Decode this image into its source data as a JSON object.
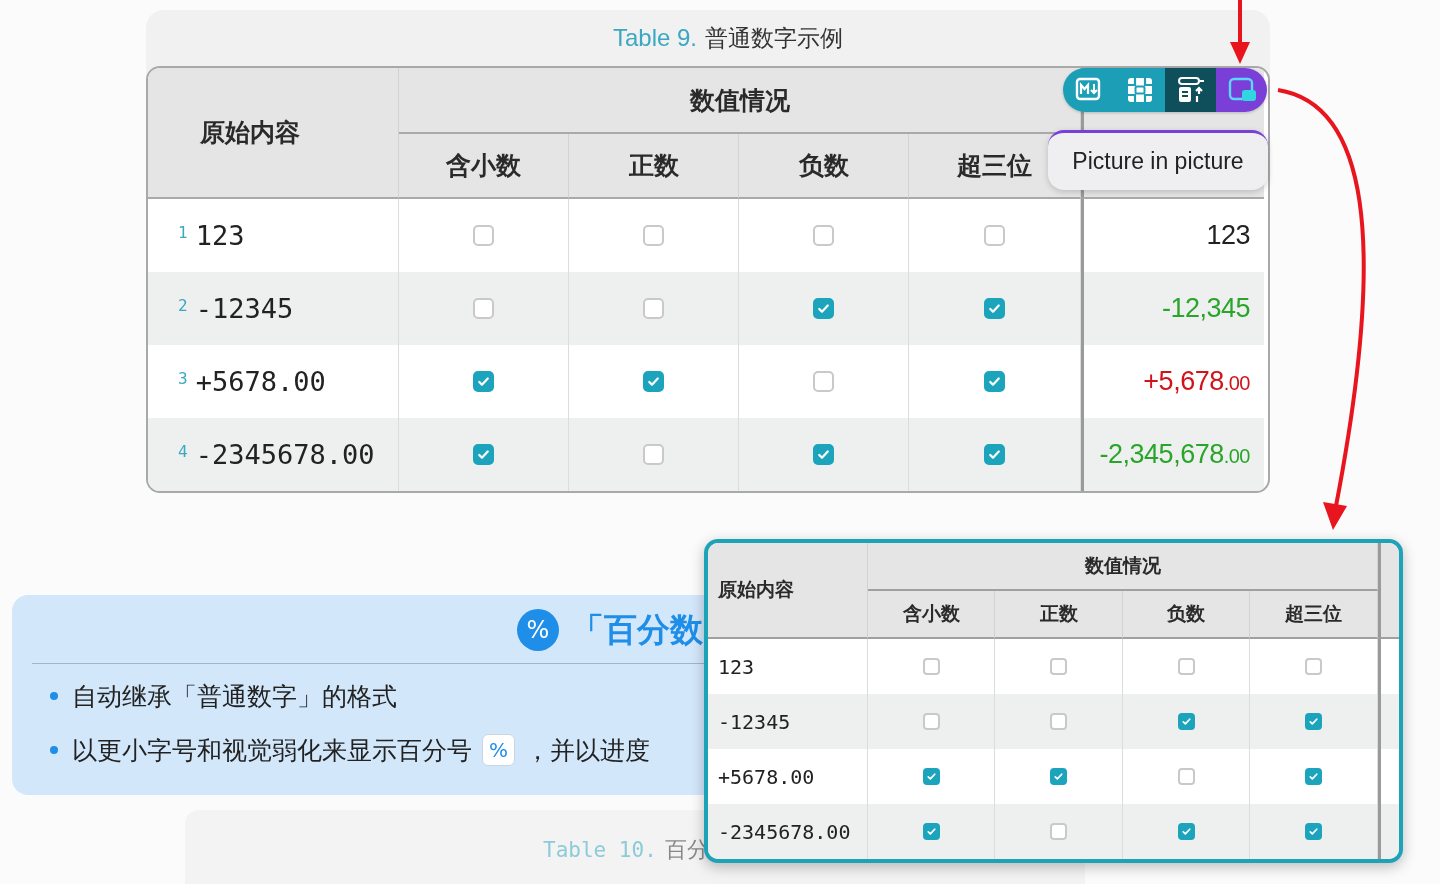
{
  "main_table": {
    "caption": {
      "label": "Table 9.",
      "title": "普通数字示例"
    },
    "first_header": "原始内容",
    "group_header": "数值情况",
    "columns": [
      "含小数",
      "正数",
      "负数",
      "超三位"
    ],
    "rows": [
      {
        "index": "1",
        "raw": "123",
        "checks": [
          false,
          false,
          false,
          false
        ],
        "value": "123",
        "kind": "neutral"
      },
      {
        "index": "2",
        "raw": "-12345",
        "checks": [
          false,
          false,
          true,
          true
        ],
        "value": "-12,345",
        "kind": "negative"
      },
      {
        "index": "3",
        "raw": "+5678.00",
        "checks": [
          true,
          true,
          false,
          true
        ],
        "value": "+5,678",
        "decimals": ".00",
        "kind": "positive"
      },
      {
        "index": "4",
        "raw": "-2345678.00",
        "checks": [
          true,
          false,
          true,
          true
        ],
        "value": "-2,345,678",
        "decimals": ".00",
        "kind": "negative"
      }
    ]
  },
  "toolbar": {
    "buttons": [
      {
        "kind": "markdown",
        "color": "#1c9fb6"
      },
      {
        "kind": "layout",
        "color": "#1c9fb6"
      },
      {
        "kind": "transform",
        "color": "#0f4f5b"
      },
      {
        "kind": "pip",
        "color": "#7a3fd6"
      }
    ]
  },
  "tooltip": "Picture in picture",
  "callout": {
    "icon": "%",
    "title": "「百分数",
    "bullets": [
      [
        {
          "kind": "text",
          "text": "自动继承「普通数字」的格式"
        }
      ],
      [
        {
          "kind": "text",
          "text": "以更小字号和视觉弱化来显示百分号"
        },
        {
          "kind": "chip",
          "text": "%"
        },
        {
          "kind": "text",
          "text": "，并以进度"
        }
      ]
    ]
  },
  "next_caption": {
    "label": "Table 10.",
    "title": "百分"
  },
  "pip_window": {
    "first_header": "原始内容",
    "group_header": "数值情况",
    "columns": [
      "含小数",
      "正数",
      "负数",
      "超三位"
    ],
    "rows": [
      {
        "raw": "123",
        "checks": [
          false,
          false,
          false,
          false
        ]
      },
      {
        "raw": "-12345",
        "checks": [
          false,
          false,
          true,
          true
        ]
      },
      {
        "raw": "+5678.00",
        "checks": [
          true,
          true,
          false,
          true
        ]
      },
      {
        "raw": "-2345678.00",
        "checks": [
          true,
          false,
          true,
          true
        ]
      }
    ]
  }
}
